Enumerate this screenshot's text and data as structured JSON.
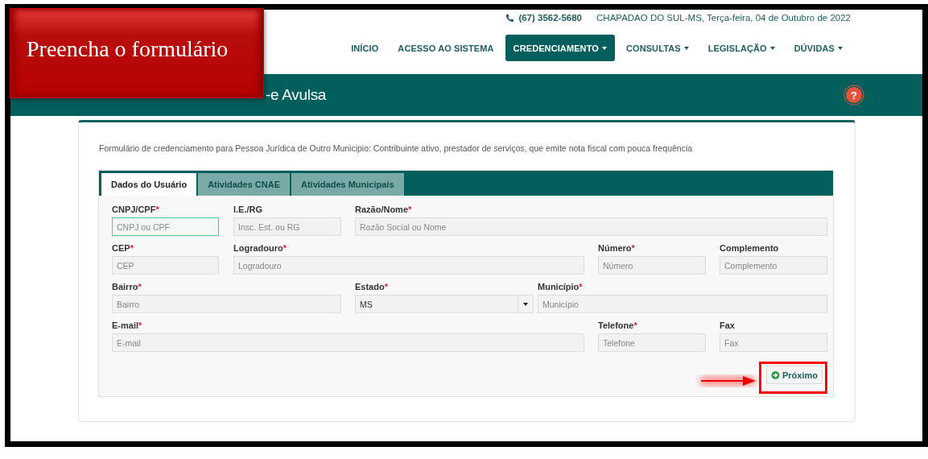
{
  "header": {
    "phone": "(67) 3562-5680",
    "location_date": "CHAPADAO DO SUL-MS, Terça-feira, 04 de Outubro de 2022",
    "nav": [
      {
        "label": "INÍCIO",
        "selected": false,
        "dropdown": false
      },
      {
        "label": "ACESSO AO SISTEMA",
        "selected": false,
        "dropdown": false
      },
      {
        "label": "CREDENCIAMENTO",
        "selected": true,
        "dropdown": true
      },
      {
        "label": "CONSULTAS",
        "selected": false,
        "dropdown": true
      },
      {
        "label": "LEGISLAÇÃO",
        "selected": false,
        "dropdown": true
      },
      {
        "label": "DÚVIDAS",
        "selected": false,
        "dropdown": true
      }
    ]
  },
  "page_title": {
    "text": "-e Avulsa",
    "help_button": "?"
  },
  "form": {
    "description": "Formulário de credenciamento para Pessoa Jurídica de Outro Municipio: Contribuinte ativo, prestador de serviços, que emite nota fiscal com pouca frequência",
    "tabs": [
      {
        "label": "Dados do Usuário",
        "selected": true
      },
      {
        "label": "Atividades CNAE",
        "selected": false
      },
      {
        "label": "Atividades Municipais",
        "selected": false
      }
    ],
    "fields": [
      {
        "label": "CNPJ/CPF",
        "required_mark": "*",
        "kind": "text",
        "placeholder": "CNPJ ou CPF",
        "focused": true
      },
      {
        "label": "I.E./RG",
        "kind": "text",
        "placeholder": "Insc. Est. ou RG",
        "focused": false
      },
      {
        "label": "Razão/Nome",
        "required_mark": "*",
        "kind": "text",
        "placeholder": "Razão Social ou Nome",
        "focused": false
      },
      {
        "label": "CEP",
        "required_mark": "*",
        "kind": "text",
        "placeholder": "CEP",
        "focused": false
      },
      {
        "label": "Logradouro",
        "required_mark": "*",
        "kind": "text",
        "placeholder": "Logradouro",
        "focused": false
      },
      {
        "label": "Número",
        "required_mark": "*",
        "kind": "text",
        "placeholder": "Número",
        "focused": false
      },
      {
        "label": "Complemento",
        "kind": "text",
        "placeholder": "Complemento",
        "focused": false
      },
      {
        "label": "Bairro",
        "required_mark": "*",
        "kind": "text",
        "placeholder": "Bairro",
        "focused": false
      },
      {
        "label": "Estado",
        "required_mark": "*",
        "kind": "select",
        "value": "MS",
        "focused": false
      },
      {
        "label": "Município",
        "required_mark": "*",
        "kind": "text",
        "placeholder": "Município",
        "focused": false
      },
      {
        "label": "E-mail",
        "required_mark": "*",
        "kind": "text",
        "placeholder": "E-mail",
        "focused": false
      },
      {
        "label": "Telefone",
        "required_mark": "*",
        "kind": "text",
        "placeholder": "Telefone",
        "focused": false
      },
      {
        "label": "Fax",
        "kind": "text",
        "placeholder": "Fax",
        "focused": false
      }
    ],
    "next_button": "Próximo"
  },
  "annotation": {
    "banner": "Preencha o formulário",
    "highlight_next": true
  }
}
